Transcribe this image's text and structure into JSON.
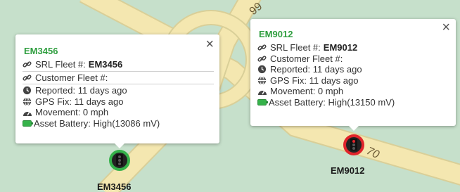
{
  "map": {
    "road_labels": [
      "99",
      "70"
    ]
  },
  "markers": [
    {
      "id": "EM3456",
      "ring_color": "#35b24a",
      "label": "EM3456",
      "popup": {
        "title": "EM3456",
        "srl_label": "SRL Fleet #:",
        "srl_value": "EM3456",
        "customer_label": "Customer Fleet #:",
        "reported": "Reported: 11 days ago",
        "gps_fix": "GPS Fix: 11 days ago",
        "movement": "Movement: 0 mph",
        "battery": "Asset Battery: High(13086 mV)"
      }
    },
    {
      "id": "EM9012",
      "ring_color": "#e0242b",
      "label": "EM9012",
      "popup": {
        "title": "EM9012",
        "srl_label": "SRL Fleet #:",
        "srl_value": "EM9012",
        "customer_label": "Customer Fleet #:",
        "reported": "Reported: 11 days ago",
        "gps_fix": "GPS Fix: 11 days ago",
        "movement": "Movement: 0 mph",
        "battery": "Asset Battery: High(13150 mV)"
      }
    }
  ],
  "colors": {
    "title_green": "#2f9e3f",
    "battery_green": "#35b24a",
    "road": "#f4e7b0"
  }
}
